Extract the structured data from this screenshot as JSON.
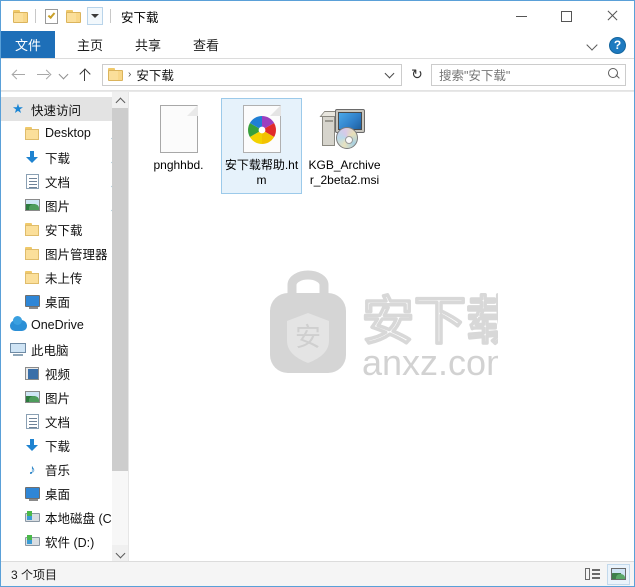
{
  "window": {
    "title": "安下载",
    "quick_access_toolbar": [
      {
        "name": "folder-icon",
        "tooltip": "属性"
      },
      {
        "name": "properties-icon",
        "tooltip": "属性"
      },
      {
        "name": "new-folder-icon",
        "tooltip": "新建文件夹"
      },
      {
        "name": "customize-dropdown",
        "tooltip": "自定义快速访问工具栏"
      }
    ],
    "controls": {
      "minimize": "最小化",
      "maximize": "最大化",
      "close": "关闭"
    }
  },
  "ribbon": {
    "tabs": [
      {
        "label": "文件",
        "active": true
      },
      {
        "label": "主页",
        "active": false
      },
      {
        "label": "共享",
        "active": false
      },
      {
        "label": "查看",
        "active": false
      }
    ],
    "collapse_tooltip": "展开功能区",
    "help_label": "?"
  },
  "address_bar": {
    "back_tooltip": "后退",
    "forward_tooltip": "前进",
    "recent_tooltip": "最近浏览的位置",
    "up_tooltip": "上移到",
    "breadcrumb": [
      {
        "label": "安下载"
      }
    ],
    "separator": "›",
    "dropdown_tooltip": "以前的位置",
    "refresh_glyph": "↻",
    "refresh_tooltip": "刷新"
  },
  "search": {
    "placeholder": "搜索\"安下载\""
  },
  "navigation_pane": {
    "items": [
      {
        "label": "快速访问",
        "icon": "star-icon",
        "level": 0,
        "selected": true,
        "pinned": false
      },
      {
        "label": "Desktop",
        "icon": "folder-icon",
        "level": 1,
        "selected": false,
        "pinned": true
      },
      {
        "label": "下载",
        "icon": "downloads-icon",
        "level": 1,
        "selected": false,
        "pinned": true
      },
      {
        "label": "文档",
        "icon": "documents-icon",
        "level": 1,
        "selected": false,
        "pinned": true
      },
      {
        "label": "图片",
        "icon": "pictures-icon",
        "level": 1,
        "selected": false,
        "pinned": true
      },
      {
        "label": "安下载",
        "icon": "folder-icon",
        "level": 1,
        "selected": false,
        "pinned": false
      },
      {
        "label": "图片管理器",
        "icon": "folder-icon",
        "level": 1,
        "selected": false,
        "pinned": false
      },
      {
        "label": "未上传",
        "icon": "folder-icon",
        "level": 1,
        "selected": false,
        "pinned": false
      },
      {
        "label": "桌面",
        "icon": "desktop-icon",
        "level": 1,
        "selected": false,
        "pinned": false
      },
      {
        "label": "OneDrive",
        "icon": "onedrive-icon",
        "level": 0,
        "selected": false,
        "pinned": false
      },
      {
        "label": "此电脑",
        "icon": "this-pc-icon",
        "level": 0,
        "selected": false,
        "pinned": false
      },
      {
        "label": "视频",
        "icon": "videos-icon",
        "level": 1,
        "selected": false,
        "pinned": false
      },
      {
        "label": "图片",
        "icon": "pictures-icon",
        "level": 1,
        "selected": false,
        "pinned": false
      },
      {
        "label": "文档",
        "icon": "documents-icon",
        "level": 1,
        "selected": false,
        "pinned": false
      },
      {
        "label": "下载",
        "icon": "downloads-icon",
        "level": 1,
        "selected": false,
        "pinned": false
      },
      {
        "label": "音乐",
        "icon": "music-icon",
        "level": 1,
        "selected": false,
        "pinned": false
      },
      {
        "label": "桌面",
        "icon": "desktop-icon",
        "level": 1,
        "selected": false,
        "pinned": false
      },
      {
        "label": "本地磁盘 (C",
        "icon": "disk-icon",
        "level": 1,
        "selected": false,
        "pinned": false
      },
      {
        "label": "软件 (D:)",
        "icon": "disk-icon",
        "level": 1,
        "selected": false,
        "pinned": false
      }
    ],
    "pin_glyph": "📌",
    "star_glyph": "★"
  },
  "file_list": {
    "items": [
      {
        "name": "pnghhbd.",
        "icon": "blank-page-icon",
        "selected": false
      },
      {
        "name": "安下载帮助.htm",
        "icon": "html-document-icon",
        "selected": true
      },
      {
        "name": "KGB_Archiver_2beta2.msi",
        "icon": "msi-installer-icon",
        "selected": false
      }
    ]
  },
  "watermark": {
    "logo_char": "安",
    "title": "安下载",
    "domain": "anxz.com"
  },
  "status_bar": {
    "item_count": "3 个项目",
    "views": [
      {
        "name": "details-view-button",
        "label": "详细信息",
        "active": false
      },
      {
        "name": "large-icons-view-button",
        "label": "大图标",
        "active": true
      }
    ]
  },
  "colors": {
    "accent": "#1e6fb8",
    "selection_bg": "#e6f2fb",
    "selection_border": "#9ccaea",
    "nav_selected_bg": "#e3e3e3",
    "folder_yellow": "#fbdf9a",
    "window_border": "#5aa0d8",
    "watermark_gray": "#d5d5d5"
  }
}
